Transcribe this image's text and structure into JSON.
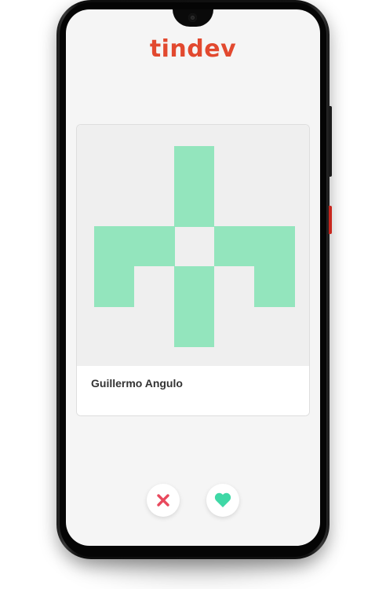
{
  "app": {
    "logo_text": "tindev",
    "brand_color": "#e2492f"
  },
  "profile": {
    "name": "Guillermo Angulo",
    "avatar": {
      "type": "identicon",
      "color": "#93e5bd",
      "background": "#efefef"
    }
  },
  "actions": {
    "dislike": {
      "icon": "close-icon",
      "color": "#e8495d"
    },
    "like": {
      "icon": "heart-icon",
      "color": "#3fd8a6"
    }
  }
}
